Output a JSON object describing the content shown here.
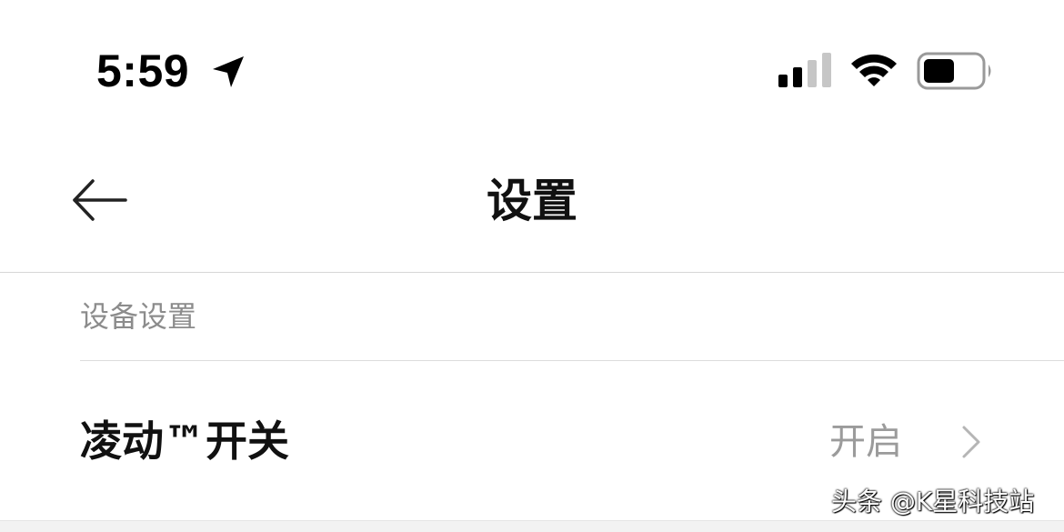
{
  "status_bar": {
    "time": "5:59",
    "location_icon": "location-arrow-icon",
    "signal_icon": "cellular-signal-icon",
    "signal_bars_active": 2,
    "signal_bars_total": 4,
    "wifi_icon": "wifi-icon",
    "battery_icon": "battery-icon",
    "battery_level": 0.45
  },
  "header": {
    "back_icon": "arrow-left-icon",
    "title": "设置"
  },
  "section": {
    "title": "设备设置"
  },
  "rows": [
    {
      "label": "凌动™开关",
      "value": "开启",
      "chevron_icon": "chevron-right-icon"
    }
  ],
  "watermark": "头条 @K星科技站",
  "colors": {
    "background": "#ffffff",
    "title_text": "#111111",
    "secondary_text": "#8c8c8c",
    "divider": "#d7d7d7"
  }
}
